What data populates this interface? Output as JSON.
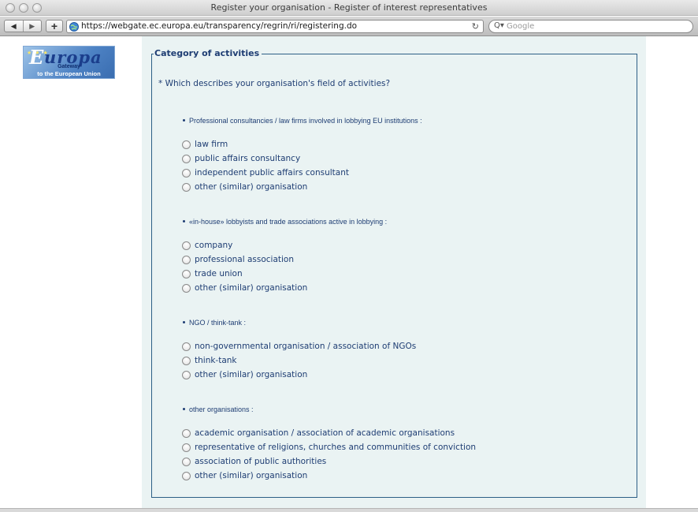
{
  "window": {
    "title": "Register your organisation - Register of interest representatives"
  },
  "toolbar": {
    "back_glyph": "◀",
    "forward_glyph": "▶",
    "new_tab_glyph": "+",
    "url": "https://webgate.ec.europa.eu/transparency/regrin/ri/registering.do",
    "reload_glyph": "↻",
    "search_placeholder": "Google",
    "search_glyph": "Q▾"
  },
  "logo": {
    "word": "uropa",
    "initial": "E",
    "line1": "Gateway",
    "line2": "to the European Union",
    "stars": "★ ★ ★"
  },
  "form": {
    "legend": "Category of activities",
    "question": "* Which describes your organisation's field of activities?",
    "groups": [
      {
        "heading": "Professional consultancies / law firms involved in lobbying EU institutions :",
        "options": [
          "law firm",
          "public affairs consultancy",
          "independent public affairs consultant",
          "other (similar) organisation"
        ]
      },
      {
        "heading": "«in-house» lobbyists and trade associations active in lobbying :",
        "options": [
          "company",
          "professional association",
          "trade union",
          "other (similar) organisation"
        ]
      },
      {
        "heading": "NGO / think-tank :",
        "options": [
          "non-governmental organisation / association of NGOs",
          "think-tank",
          "other (similar) organisation"
        ]
      },
      {
        "heading": "other organisations :",
        "options": [
          "academic organisation / association of academic organisations",
          "representative of religions, churches and communities of conviction",
          "association of public authorities",
          "other (similar) organisation"
        ]
      }
    ]
  },
  "colors": {
    "text_blue": "#1e3d73",
    "panel_bg": "#eaf3f3",
    "border_blue": "#2d5f86"
  }
}
